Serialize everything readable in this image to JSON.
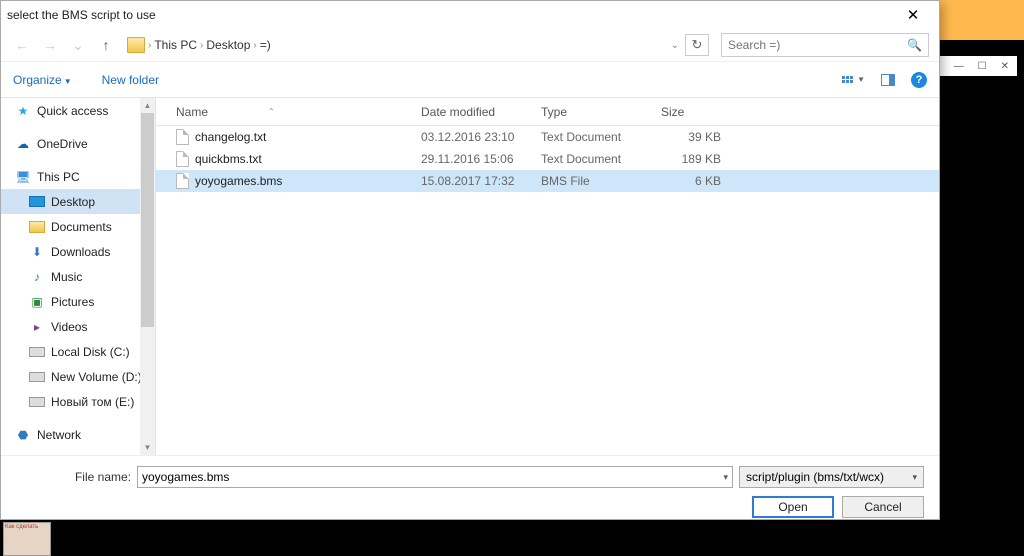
{
  "window": {
    "title": "select the BMS script to use",
    "close": "✕"
  },
  "nav": {
    "back": "←",
    "forward": "→",
    "up": "↑",
    "refresh": "↻",
    "crumbs": [
      "This PC",
      "Desktop",
      "=)"
    ],
    "dropdown": "⌄",
    "search_placeholder": "Search =)",
    "search_icon": "🔍"
  },
  "toolbar": {
    "organize": "Organize",
    "new_folder": "New folder",
    "tri": "▼",
    "help": "?"
  },
  "tree": {
    "quick_access": "Quick access",
    "onedrive": "OneDrive",
    "this_pc": "This PC",
    "desktop": "Desktop",
    "documents": "Documents",
    "downloads": "Downloads",
    "music": "Music",
    "pictures": "Pictures",
    "videos": "Videos",
    "local_disk": "Local Disk (C:)",
    "new_volume": "New Volume (D:)",
    "novy_tom": "Новый том (E:)",
    "network": "Network"
  },
  "columns": {
    "name": "Name",
    "date": "Date modified",
    "type": "Type",
    "size": "Size",
    "sort": "⌃"
  },
  "files": [
    {
      "name": "changelog.txt",
      "date": "03.12.2016 23:10",
      "type": "Text Document",
      "size": "39 KB",
      "selected": false
    },
    {
      "name": "quickbms.txt",
      "date": "29.11.2016 15:06",
      "type": "Text Document",
      "size": "189 KB",
      "selected": false
    },
    {
      "name": "yoyogames.bms",
      "date": "15.08.2017 17:32",
      "type": "BMS File",
      "size": "6 KB",
      "selected": true
    }
  ],
  "footer": {
    "filename_label": "File name:",
    "filename_value": "yoyogames.bms",
    "filter": "script/plugin (bms/txt/wcx)",
    "open": "Open",
    "cancel": "Cancel"
  },
  "win2": {
    "min": "—",
    "max": "☐",
    "close": "✕"
  }
}
